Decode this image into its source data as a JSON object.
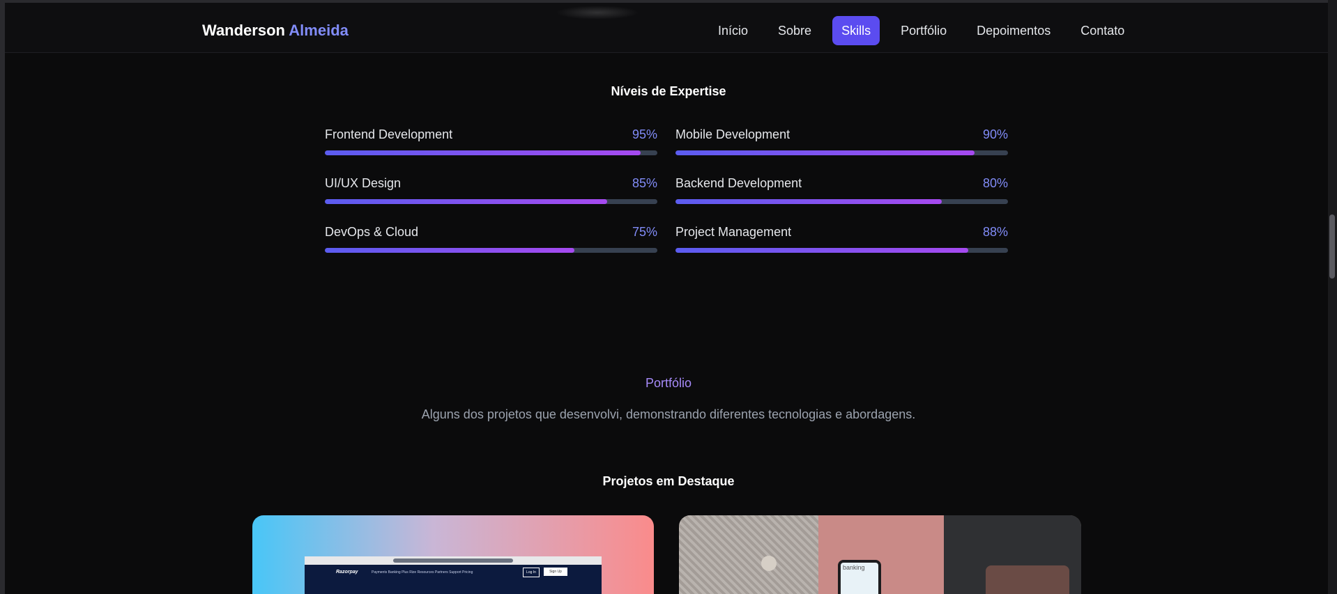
{
  "brand": {
    "first": "Wanderson",
    "last": "Almeida"
  },
  "nav": [
    {
      "label": "Início",
      "active": false
    },
    {
      "label": "Sobre",
      "active": false
    },
    {
      "label": "Skills",
      "active": true
    },
    {
      "label": "Portfólio",
      "active": false
    },
    {
      "label": "Depoimentos",
      "active": false
    },
    {
      "label": "Contato",
      "active": false
    }
  ],
  "expertise": {
    "title": "Níveis de Expertise",
    "skills": [
      {
        "name": "Frontend Development",
        "percent_label": "95%",
        "level": 0.95
      },
      {
        "name": "Mobile Development",
        "percent_label": "90%",
        "level": 0.9
      },
      {
        "name": "UI/UX Design",
        "percent_label": "85%",
        "level": 0.85
      },
      {
        "name": "Backend Development",
        "percent_label": "80%",
        "level": 0.8
      },
      {
        "name": "DevOps & Cloud",
        "percent_label": "75%",
        "level": 0.75
      },
      {
        "name": "Project Management",
        "percent_label": "88%",
        "level": 0.88
      }
    ]
  },
  "portfolio": {
    "label": "Portfólio",
    "subtitle": "Alguns dos projetos que desenvolvi, demonstrando diferentes tecnologias e abordagens.",
    "featured_title": "Projetos em Destaque",
    "card1_preview": {
      "logo": "Razorpay",
      "nav": "Payments   Banking Plus   Rize   Resources   Partners   Support   Pricing",
      "login": "Log In",
      "signup": "Sign Up"
    },
    "card2_preview": {
      "screen_text": "banking"
    }
  },
  "colors": {
    "accent": "#818cf8",
    "active_nav": "#5b4cf0",
    "bar_start": "#5b5cf0",
    "bar_end": "#a64af0"
  }
}
